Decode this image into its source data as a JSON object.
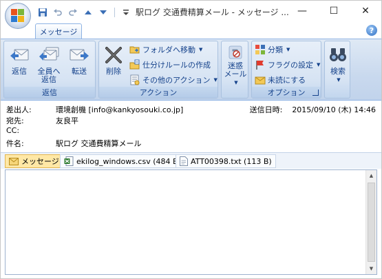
{
  "window": {
    "title": "駅ログ 交通費精算メール - メッセージ ...",
    "minimize": "—",
    "maximize": "☐",
    "close": "✕"
  },
  "tabs": [
    {
      "label": "メッセージ",
      "active": true
    }
  ],
  "help": "?",
  "ribbon": {
    "groups": {
      "reply": {
        "label": "返信",
        "buttons": {
          "reply": "返信",
          "reply_all_line1": "全員へ",
          "reply_all_line2": "返信",
          "forward": "転送"
        }
      },
      "actions": {
        "label": "アクション",
        "delete": "削除",
        "move_to_folder": "フォルダへ移動",
        "create_rule": "仕分けルールの作成",
        "other_actions": "その他のアクション"
      },
      "junk": {
        "line1": "迷惑",
        "line2": "メール"
      },
      "options": {
        "label": "オプション",
        "categorize": "分類",
        "follow_up": "フラグの設定",
        "mark_unread": "未読にする"
      },
      "find": {
        "search": "検索"
      }
    }
  },
  "headers": {
    "from_label": "差出人:",
    "from_value": "環境創機 [info@kankyosouki.co.jp]",
    "to_label": "宛先:",
    "to_value": "友良平",
    "cc_label": "CC:",
    "cc_value": "",
    "subject_label": "件名:",
    "subject_value": "駅ログ 交通費精算メール",
    "sent_label": "送信日時:",
    "sent_value": "2015/09/10 (木) 14:46"
  },
  "attachments": [
    {
      "label": "メッセージ",
      "selected": true,
      "icon": "envelope-icon"
    },
    {
      "label": "ekilog_windows.csv (484 B)",
      "selected": false,
      "icon": "excel-file-icon"
    },
    {
      "label": "ATT00398.txt (113 B)",
      "selected": false,
      "icon": "text-file-icon"
    }
  ],
  "colors": {
    "ribbon_text": "#15428b",
    "accent_blue": "#8db2e3"
  }
}
